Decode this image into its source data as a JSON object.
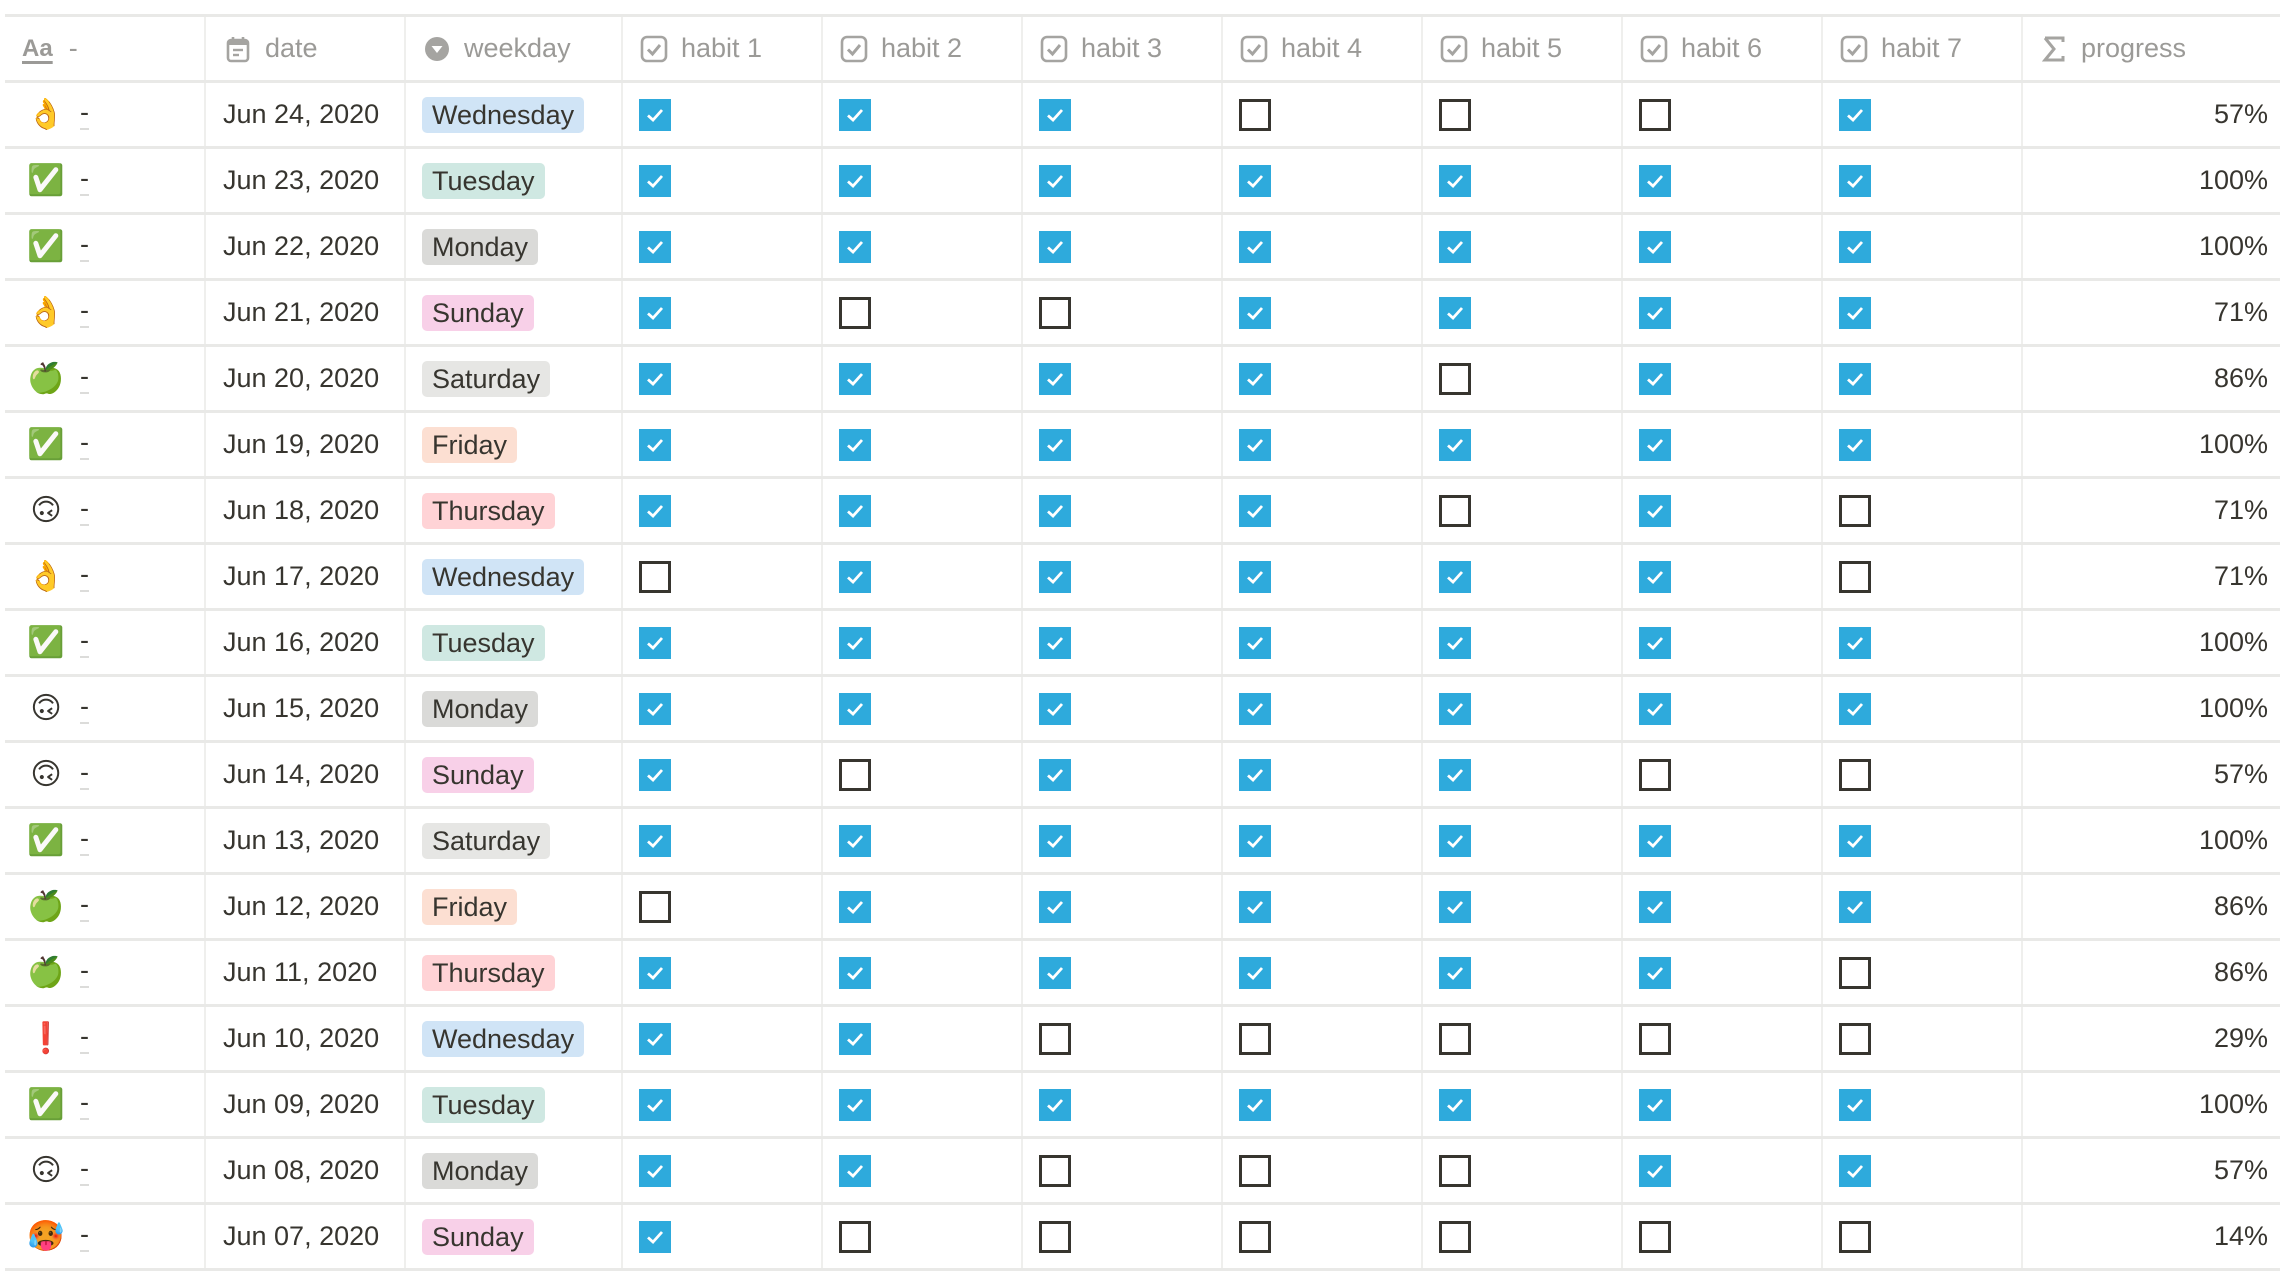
{
  "header": {
    "title_col": {
      "icon": "text-aa-icon",
      "icon_text": "Aa",
      "label": "-"
    },
    "date_col": {
      "icon": "calendar-icon",
      "label": "date"
    },
    "weekday_col": {
      "icon": "select-dropdown-icon",
      "label": "weekday"
    },
    "habit_cols": [
      {
        "icon": "checkbox-icon",
        "label": "habit 1"
      },
      {
        "icon": "checkbox-icon",
        "label": "habit 2"
      },
      {
        "icon": "checkbox-icon",
        "label": "habit 3"
      },
      {
        "icon": "checkbox-icon",
        "label": "habit 4"
      },
      {
        "icon": "checkbox-icon",
        "label": "habit 5"
      },
      {
        "icon": "checkbox-icon",
        "label": "habit 6"
      },
      {
        "icon": "checkbox-icon",
        "label": "habit 7"
      }
    ],
    "progress_col": {
      "icon": "sigma-formula-icon",
      "label": "progress"
    }
  },
  "weekday_colors": {
    "Monday": "#dadad8",
    "Tuesday": "#cfe8e2",
    "Wednesday": "#d0e4f6",
    "Thursday": "#ffd3d6",
    "Friday": "#fcdfd2",
    "Saturday": "#e6e6e4",
    "Sunday": "#f8d0e8"
  },
  "checkbox_color": "#2eaadc",
  "rows": [
    {
      "emoji": "👌",
      "emoji_name": "ok-hand-icon",
      "title": "-",
      "date": "Jun 24, 2020",
      "weekday": "Wednesday",
      "habits": [
        true,
        true,
        true,
        false,
        false,
        false,
        true
      ],
      "progress": "57%"
    },
    {
      "emoji": "✅",
      "emoji_name": "check-mark-button-icon",
      "title": "-",
      "date": "Jun 23, 2020",
      "weekday": "Tuesday",
      "habits": [
        true,
        true,
        true,
        true,
        true,
        true,
        true
      ],
      "progress": "100%"
    },
    {
      "emoji": "✅",
      "emoji_name": "check-mark-button-icon",
      "title": "-",
      "date": "Jun 22, 2020",
      "weekday": "Monday",
      "habits": [
        true,
        true,
        true,
        true,
        true,
        true,
        true
      ],
      "progress": "100%"
    },
    {
      "emoji": "👌",
      "emoji_name": "ok-hand-icon",
      "title": "-",
      "date": "Jun 21, 2020",
      "weekday": "Sunday",
      "habits": [
        true,
        false,
        false,
        true,
        true,
        true,
        true
      ],
      "progress": "71%"
    },
    {
      "emoji": "🍏",
      "emoji_name": "green-apple-icon",
      "title": "-",
      "date": "Jun 20, 2020",
      "weekday": "Saturday",
      "habits": [
        true,
        true,
        true,
        true,
        false,
        true,
        true
      ],
      "progress": "86%"
    },
    {
      "emoji": "✅",
      "emoji_name": "check-mark-button-icon",
      "title": "-",
      "date": "Jun 19, 2020",
      "weekday": "Friday",
      "habits": [
        true,
        true,
        true,
        true,
        true,
        true,
        true
      ],
      "progress": "100%"
    },
    {
      "emoji": "🙃",
      "emoji_name": "upside-down-face-icon",
      "title": "-",
      "date": "Jun 18, 2020",
      "weekday": "Thursday",
      "habits": [
        true,
        true,
        true,
        true,
        false,
        true,
        false
      ],
      "progress": "71%"
    },
    {
      "emoji": "👌",
      "emoji_name": "ok-hand-icon",
      "title": "-",
      "date": "Jun 17, 2020",
      "weekday": "Wednesday",
      "habits": [
        false,
        true,
        true,
        true,
        true,
        true,
        false
      ],
      "progress": "71%"
    },
    {
      "emoji": "✅",
      "emoji_name": "check-mark-button-icon",
      "title": "-",
      "date": "Jun 16, 2020",
      "weekday": "Tuesday",
      "habits": [
        true,
        true,
        true,
        true,
        true,
        true,
        true
      ],
      "progress": "100%"
    },
    {
      "emoji": "🙃",
      "emoji_name": "upside-down-face-icon",
      "title": "-",
      "date": "Jun 15, 2020",
      "weekday": "Monday",
      "habits": [
        true,
        true,
        true,
        true,
        true,
        true,
        true
      ],
      "progress": "100%"
    },
    {
      "emoji": "🙃",
      "emoji_name": "upside-down-face-icon",
      "title": "-",
      "date": "Jun 14, 2020",
      "weekday": "Sunday",
      "habits": [
        true,
        false,
        true,
        true,
        true,
        false,
        false
      ],
      "progress": "57%"
    },
    {
      "emoji": "✅",
      "emoji_name": "check-mark-button-icon",
      "title": "-",
      "date": "Jun 13, 2020",
      "weekday": "Saturday",
      "habits": [
        true,
        true,
        true,
        true,
        true,
        true,
        true
      ],
      "progress": "100%"
    },
    {
      "emoji": "🍏",
      "emoji_name": "green-apple-icon",
      "title": "-",
      "date": "Jun 12, 2020",
      "weekday": "Friday",
      "habits": [
        false,
        true,
        true,
        true,
        true,
        true,
        true
      ],
      "progress": "86%"
    },
    {
      "emoji": "🍏",
      "emoji_name": "green-apple-icon",
      "title": "-",
      "date": "Jun 11, 2020",
      "weekday": "Thursday",
      "habits": [
        true,
        true,
        true,
        true,
        true,
        true,
        false
      ],
      "progress": "86%"
    },
    {
      "emoji": "❗",
      "emoji_name": "exclamation-mark-icon",
      "title": "-",
      "date": "Jun 10, 2020",
      "weekday": "Wednesday",
      "habits": [
        true,
        true,
        false,
        false,
        false,
        false,
        false
      ],
      "progress": "29%"
    },
    {
      "emoji": "✅",
      "emoji_name": "check-mark-button-icon",
      "title": "-",
      "date": "Jun 09, 2020",
      "weekday": "Tuesday",
      "habits": [
        true,
        true,
        true,
        true,
        true,
        true,
        true
      ],
      "progress": "100%"
    },
    {
      "emoji": "🙃",
      "emoji_name": "upside-down-face-icon",
      "title": "-",
      "date": "Jun 08, 2020",
      "weekday": "Monday",
      "habits": [
        true,
        true,
        false,
        false,
        false,
        true,
        true
      ],
      "progress": "57%"
    },
    {
      "emoji": "🥵",
      "emoji_name": "hot-face-icon",
      "title": "-",
      "date": "Jun 07, 2020",
      "weekday": "Sunday",
      "habits": [
        true,
        false,
        false,
        false,
        false,
        false,
        false
      ],
      "progress": "14%"
    }
  ]
}
